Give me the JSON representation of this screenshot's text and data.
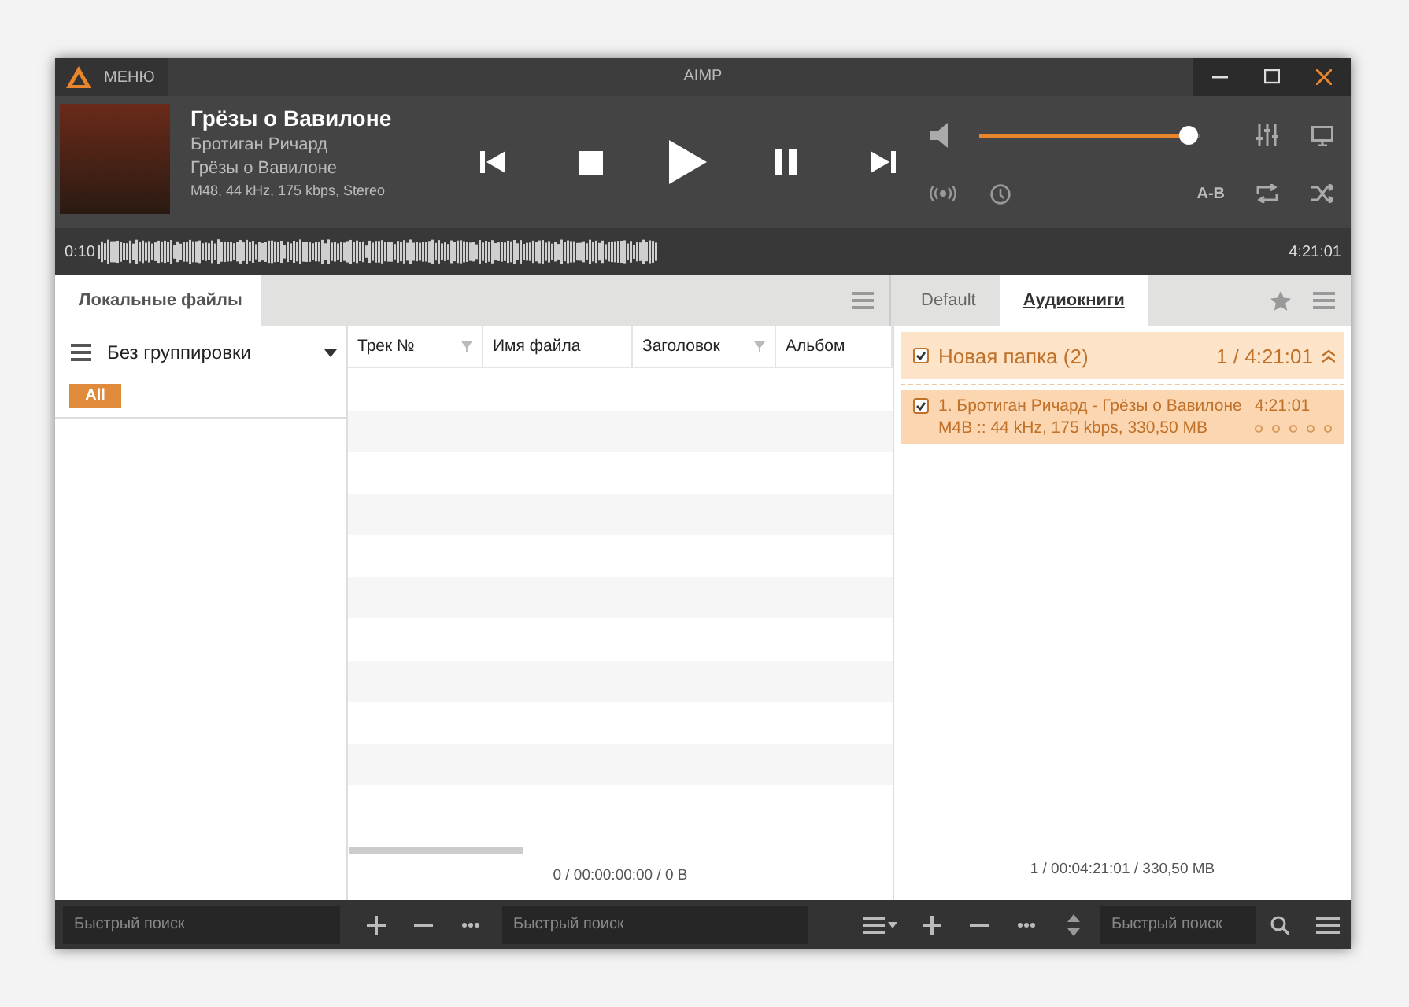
{
  "window": {
    "menu_label": "МЕНЮ",
    "title": "AIMP"
  },
  "now_playing": {
    "title": "Грёзы о Вавилоне",
    "artist": "Бротиган Ричард",
    "album": "Грёзы о Вавилоне",
    "info": "M48, 44 kHz, 175 kbps, Stereo"
  },
  "volume": {
    "level": 0.95
  },
  "ab_label": "A-B",
  "seek": {
    "elapsed": "0:10",
    "duration": "4:21:01"
  },
  "left_tabs": [
    {
      "label": "Локальные файлы",
      "selected": true
    }
  ],
  "grouping": {
    "label": "Без группировки",
    "chip": "All"
  },
  "track_table": {
    "columns": [
      {
        "label": "Трек №",
        "filter": true
      },
      {
        "label": "Имя файла",
        "filter": false
      },
      {
        "label": "Заголовок",
        "filter": true
      },
      {
        "label": "Альбом",
        "filter": false
      }
    ],
    "summary": "0 / 00:00:00:00 / 0 B"
  },
  "playlist_tabs": [
    {
      "label": "Default",
      "selected": false
    },
    {
      "label": "Аудиокниги",
      "selected": true
    }
  ],
  "playlist": {
    "group": {
      "title": "Новая папка (2)",
      "summary": "1 / 4:21:01",
      "checked": true
    },
    "tracks": [
      {
        "title": "1. Бротиган Ричард - Грёзы о Вавилоне",
        "duration": "4:21:01",
        "info": "M4B :: 44 kHz, 175 kbps, 330,50 MB",
        "checked": true,
        "stars": 0
      }
    ],
    "summary": "1 / 00:04:21:01 / 330,50 MB"
  },
  "search_fields": [
    {
      "placeholder": "Быстрый поиск"
    },
    {
      "placeholder": "Быстрый поиск"
    },
    {
      "placeholder": "Быстрый поиск"
    }
  ]
}
